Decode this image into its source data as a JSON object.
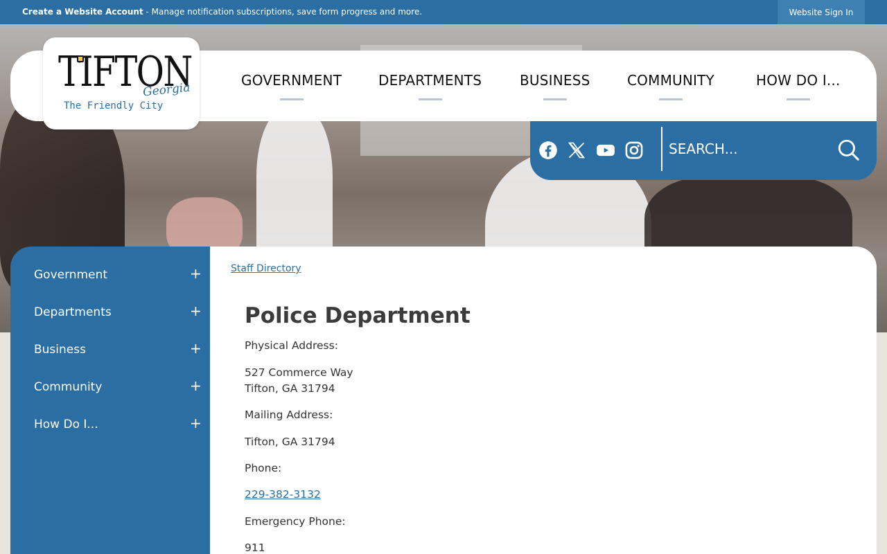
{
  "topbar": {
    "create_account": "Create a Website Account",
    "notice_rest": " - Manage notification subscriptions, save form progress and more.",
    "sign_in": "Website Sign In"
  },
  "logo": {
    "word": "TIFTON",
    "state": "Georgia",
    "tagline": "The Friendly City"
  },
  "nav": {
    "items": [
      "GOVERNMENT",
      "DEPARTMENTS",
      "BUSINESS",
      "COMMUNITY",
      "HOW DO I..."
    ]
  },
  "social": [
    "facebook-icon",
    "x-icon",
    "youtube-icon",
    "instagram-icon"
  ],
  "search": {
    "placeholder": "SEARCH..."
  },
  "sidebar": {
    "items": [
      {
        "label": "Government",
        "toggle": "+"
      },
      {
        "label": "Departments",
        "toggle": "+"
      },
      {
        "label": "Business",
        "toggle": "+"
      },
      {
        "label": "Community",
        "toggle": "+"
      },
      {
        "label": "How Do I...",
        "toggle": "+"
      }
    ]
  },
  "content": {
    "breadcrumb": "Staff Directory",
    "title": "Police Department",
    "physical_label": "Physical Address:",
    "physical_line1": "527 Commerce Way",
    "physical_line2": "Tifton, GA 31794",
    "mailing_label": "Mailing Address:",
    "mailing_line1": "Tifton, GA 31794",
    "phone_label": "Phone:",
    "phone": "229-382-3132",
    "emergency_label": "Emergency Phone:",
    "emergency": "911"
  },
  "colors": {
    "primary": "#2a6ea3",
    "signin_bg": "#3f80b3",
    "nav_underline": "#b9c7d2",
    "page_bg": "#e8e4de"
  }
}
